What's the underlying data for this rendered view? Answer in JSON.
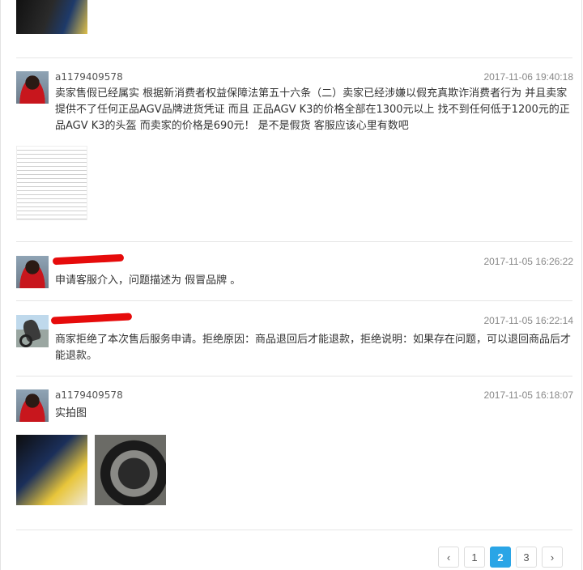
{
  "entries": [
    {
      "username": "a1179409578",
      "time": "2017-11-06 19:40:18",
      "message": "卖家售假已经属实  根据新消费者权益保障法第五十六条（二）卖家已经涉嫌以假充真欺诈消费者行为  并且卖家提供不了任何正品AGV品牌进货凭证  而且  正品AGV K3的价格全部在1300元以上  找不到任何低于1200元的正品AGV K3的头盔  而卖家的价格是690元！  是不是假货  客服应该心里有数吧"
    },
    {
      "username": "",
      "time": "2017-11-05 16:26:22",
      "message": "申请客服介入，问题描述为  假冒品牌  。"
    },
    {
      "username": "",
      "time": "2017-11-05 16:22:14",
      "message": "商家拒绝了本次售后服务申请。拒绝原因：商品退回后才能退款，拒绝说明：如果存在问题，可以退回商品后才能退款。"
    },
    {
      "username": "a1179409578",
      "time": "2017-11-05 16:18:07",
      "message": "实拍图"
    }
  ],
  "pagination": {
    "prev": "‹",
    "pages": [
      "1",
      "2",
      "3"
    ],
    "current": "2",
    "next": "›"
  },
  "colors": {
    "accent": "#2aa5e6",
    "redaction": "#e60b0b"
  }
}
